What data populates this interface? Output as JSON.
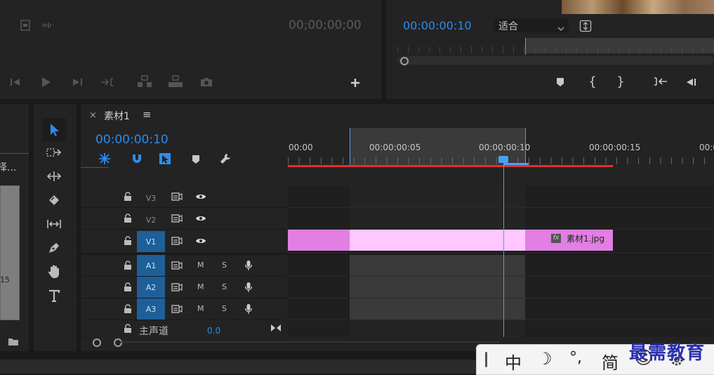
{
  "source_monitor": {
    "timecode": "00;00;00;00"
  },
  "program_monitor": {
    "timecode": "00:00:00:10",
    "fit_select": "适合"
  },
  "project_panel": {
    "partial_label": "择...",
    "partial_number": "15"
  },
  "timeline": {
    "tab_close": "×",
    "sequence_name": "素材1",
    "menu_glyph": "≡",
    "timecode": "00:00:00:10",
    "ruler_labels": [
      "00:00",
      "00:00:00:05",
      "00:00:00:10",
      "00:00:00:15",
      "00:0"
    ],
    "tracks": [
      {
        "name": "V3",
        "active": false,
        "type": "video"
      },
      {
        "name": "V2",
        "active": false,
        "type": "video"
      },
      {
        "name": "V1",
        "active": true,
        "type": "video"
      },
      {
        "name": "A1",
        "active": true,
        "type": "audio",
        "m": "M",
        "s": "S"
      },
      {
        "name": "A2",
        "active": true,
        "type": "audio",
        "m": "M",
        "s": "S"
      },
      {
        "name": "A3",
        "active": true,
        "type": "audio",
        "m": "M",
        "s": "S"
      }
    ],
    "master": {
      "label": "主声道",
      "value": "0.0"
    },
    "clip": {
      "fx": "fx",
      "name": "素材1.jpg",
      "color": "#e17fe3",
      "highlight": "#ffc6ff"
    }
  },
  "ime_bar": {
    "items": [
      "中",
      "☽",
      "°,",
      "简",
      "☺"
    ]
  },
  "watermark": "最需教育",
  "colors": {
    "accent_blue": "#2d8ceb",
    "playhead": "#4a9ff5",
    "work_area_red": "#e03030",
    "track_active": "#1f5f99"
  }
}
